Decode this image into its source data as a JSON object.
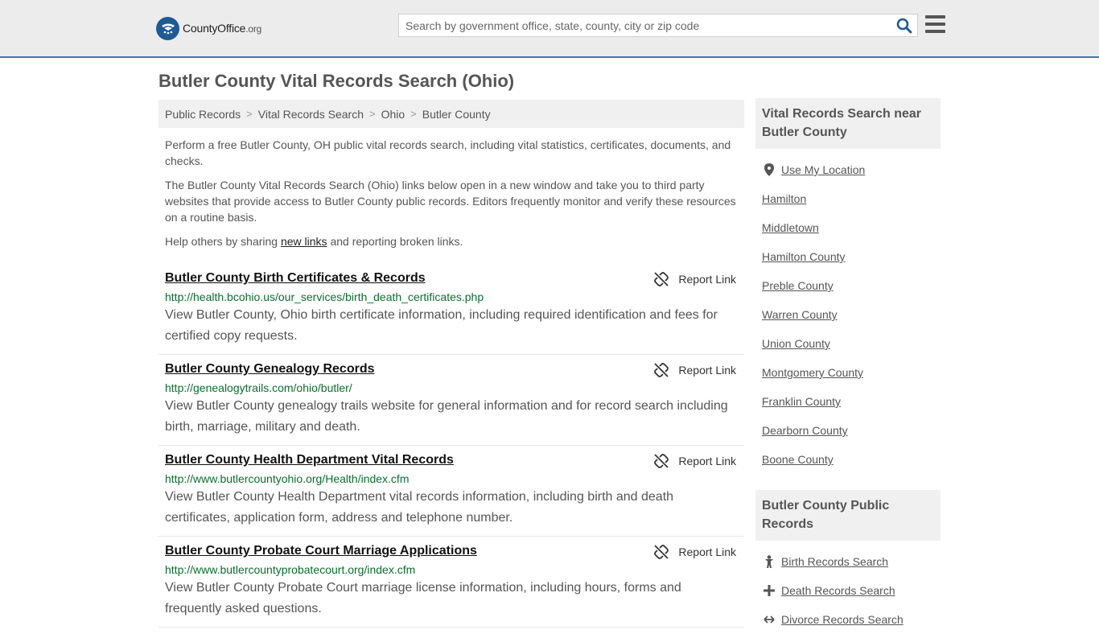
{
  "header": {
    "logo_main": "CountyOffice",
    "logo_suffix": ".org",
    "search_placeholder": "Search by government office, state, county, city or zip code"
  },
  "page_title": "Butler County Vital Records Search (Ohio)",
  "breadcrumb": [
    "Public Records",
    "Vital Records Search",
    "Ohio",
    "Butler County"
  ],
  "intro": {
    "p1": "Perform a free Butler County, OH public vital records search, including vital statistics, certificates, documents, and checks.",
    "p2": "The Butler County Vital Records Search (Ohio) links below open in a new window and take you to third party websites that provide access to Butler County public records. Editors frequently monitor and verify these resources on a routine basis.",
    "p3_before": "Help others by sharing ",
    "p3_link": "new links",
    "p3_after": " and reporting broken links."
  },
  "report_label": "Report Link",
  "results": [
    {
      "title": "Butler County Birth Certificates & Records",
      "url": "http://health.bcohio.us/our_services/birth_death_certificates.php",
      "desc": "View Butler County, Ohio birth certificate information, including required identification and fees for certified copy requests."
    },
    {
      "title": "Butler County Genealogy Records",
      "url": "http://genealogytrails.com/ohio/butler/",
      "desc": "View Butler County genealogy trails website for general information and for record search including birth, marriage, military and death."
    },
    {
      "title": "Butler County Health Department Vital Records",
      "url": "http://www.butlercountyohio.org/Health/index.cfm",
      "desc": "View Butler County Health Department vital records information, including birth and death certificates, application form, address and telephone number."
    },
    {
      "title": "Butler County Probate Court Marriage Applications",
      "url": "http://www.butlercountyprobatecourt.org/index.cfm",
      "desc": "View Butler County Probate Court marriage license information, including hours, forms and frequently asked questions."
    }
  ],
  "sidebar": {
    "nearby_title": "Vital Records Search near Butler County",
    "use_location": "Use My Location",
    "nearby": [
      "Hamilton",
      "Middletown",
      "Hamilton County",
      "Preble County",
      "Warren County",
      "Union County",
      "Montgomery County",
      "Franklin County",
      "Dearborn County",
      "Boone County"
    ],
    "public_records_title": "Butler County Public Records",
    "public_records": [
      "Birth Records Search",
      "Death Records Search",
      "Divorce Records Search"
    ]
  }
}
